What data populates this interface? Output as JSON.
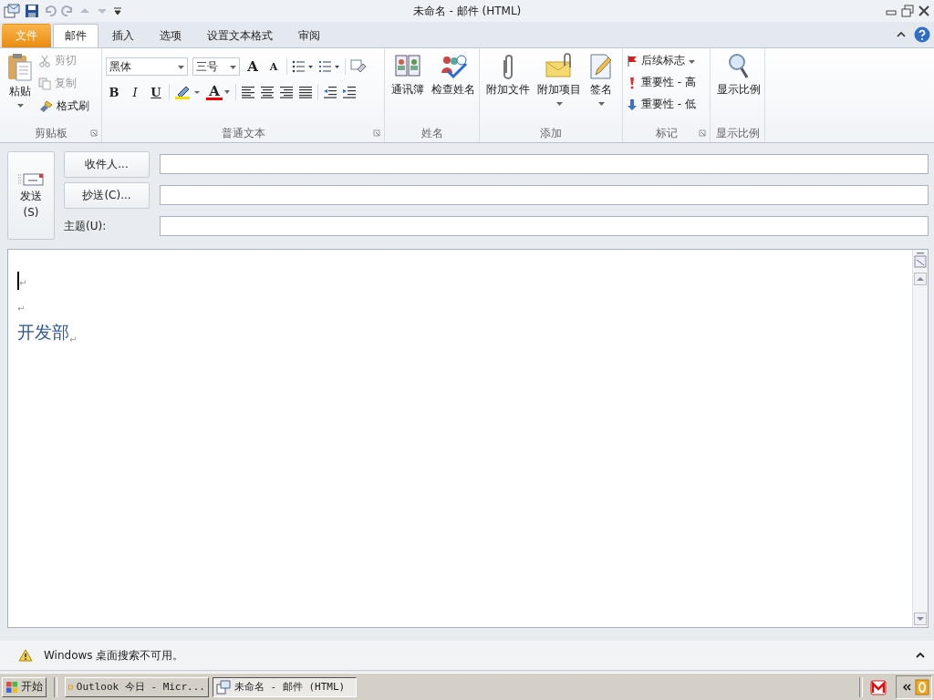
{
  "window": {
    "title": "未命名 - 邮件 (HTML)"
  },
  "tabs": [
    {
      "label": "文件",
      "kind": "file",
      "selected": false
    },
    {
      "label": "邮件",
      "kind": "tab",
      "selected": true
    },
    {
      "label": "插入",
      "kind": "tab",
      "selected": false
    },
    {
      "label": "选项",
      "kind": "tab",
      "selected": false
    },
    {
      "label": "设置文本格式",
      "kind": "tab",
      "selected": false
    },
    {
      "label": "审阅",
      "kind": "tab",
      "selected": false
    }
  ],
  "ribbon": {
    "clipboard": {
      "label": "剪贴板",
      "paste": "粘贴",
      "items": [
        {
          "label": "剪切",
          "disabled": true
        },
        {
          "label": "复制",
          "disabled": true
        },
        {
          "label": "格式刷",
          "disabled": false
        }
      ]
    },
    "basic_text": {
      "label": "普通文本",
      "font": "黑体",
      "size": "三号",
      "grow": "A",
      "shrink": "A",
      "bold": "B",
      "italic": "I",
      "underline": "U",
      "font_color": "A"
    },
    "names": {
      "label": "姓名",
      "buttons": [
        "通讯簿",
        "检查姓名"
      ]
    },
    "include": {
      "label": "添加",
      "buttons": [
        {
          "label": "附加文件",
          "dropdown": false
        },
        {
          "label": "附加项目",
          "dropdown": true
        },
        {
          "label": "签名",
          "dropdown": true
        }
      ]
    },
    "tags": {
      "label": "标记",
      "buttons": [
        "后续标志",
        "重要性 - 高",
        "重要性 - 低"
      ]
    },
    "zoom": {
      "label": "显示比例",
      "button": "显示比例"
    }
  },
  "header": {
    "send": {
      "label": "发送",
      "key": "(S)"
    },
    "to": "收件人...",
    "cc": "抄送(C)...",
    "subject_label": "主题(U):"
  },
  "body": {
    "lines": [
      {
        "cursor": true,
        "mark": "↵"
      },
      {
        "cursor": false,
        "mark": "↵"
      },
      {
        "cursor": false,
        "text": "开发部",
        "mark": "↵"
      }
    ]
  },
  "status_bar": {
    "message": "Windows 桌面搜索不可用。"
  },
  "taskbar": {
    "start": "开始",
    "tasks": [
      {
        "label": "Outlook 今日 - Micr...",
        "selected": false
      },
      {
        "label": "未命名 - 邮件 (HTML)",
        "selected": true
      }
    ]
  }
}
